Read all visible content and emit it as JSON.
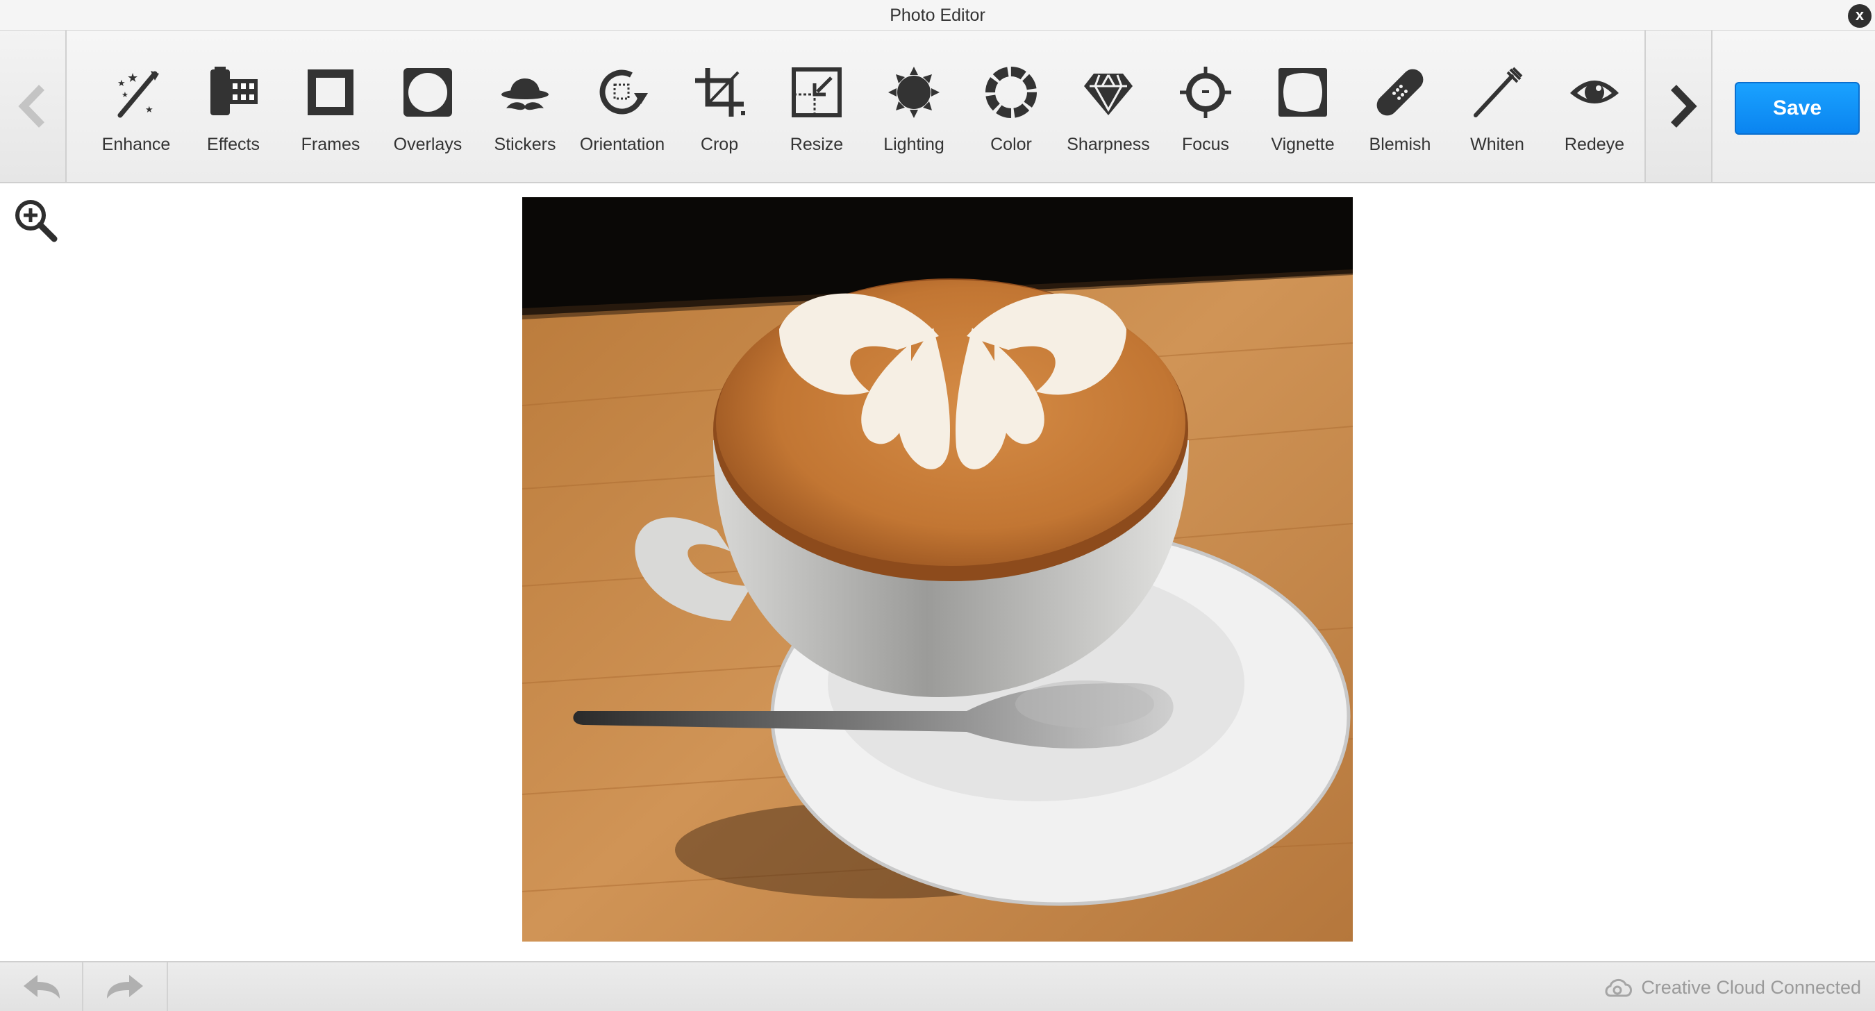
{
  "window": {
    "title": "Photo Editor"
  },
  "toolbar": {
    "tools": [
      {
        "label": "Enhance",
        "icon": "magic-wand-icon"
      },
      {
        "label": "Effects",
        "icon": "film-roll-icon"
      },
      {
        "label": "Frames",
        "icon": "frame-icon"
      },
      {
        "label": "Overlays",
        "icon": "overlay-circle-icon"
      },
      {
        "label": "Stickers",
        "icon": "hat-mustache-icon"
      },
      {
        "label": "Orientation",
        "icon": "rotate-icon"
      },
      {
        "label": "Crop",
        "icon": "crop-icon"
      },
      {
        "label": "Resize",
        "icon": "resize-icon"
      },
      {
        "label": "Lighting",
        "icon": "sun-icon"
      },
      {
        "label": "Color",
        "icon": "color-wheel-icon"
      },
      {
        "label": "Sharpness",
        "icon": "diamond-icon"
      },
      {
        "label": "Focus",
        "icon": "crosshair-icon"
      },
      {
        "label": "Vignette",
        "icon": "vignette-icon"
      },
      {
        "label": "Blemish",
        "icon": "bandage-icon"
      },
      {
        "label": "Whiten",
        "icon": "toothbrush-icon"
      },
      {
        "label": "Redeye",
        "icon": "eye-icon"
      }
    ],
    "save_label": "Save",
    "accent_color": "#0a84f0"
  },
  "footer": {
    "status_text": "Creative Cloud Connected"
  }
}
